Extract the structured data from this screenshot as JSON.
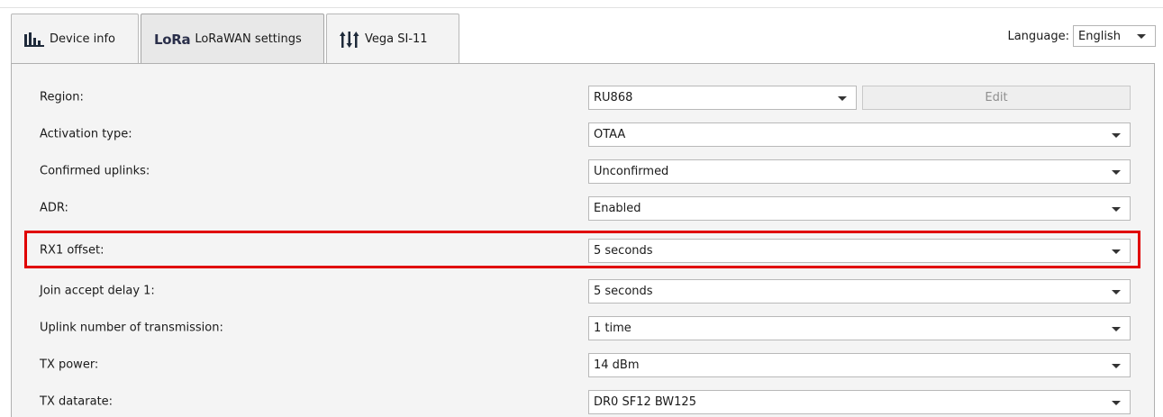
{
  "tabs": [
    {
      "label": "Device info",
      "icon": "bar-chart-icon"
    },
    {
      "label": "LoRaWAN settings",
      "logo_text": "LoRa",
      "icon": "lora-logo-icon"
    },
    {
      "label": "Vega SI-11",
      "icon": "sliders-icon"
    }
  ],
  "active_tab": "LoRaWAN settings",
  "language": {
    "label": "Language:",
    "value": "English"
  },
  "settings": {
    "region": {
      "label": "Region:",
      "value": "RU868",
      "edit_label": "Edit"
    },
    "activation_type": {
      "label": "Activation type:",
      "value": "OTAA"
    },
    "confirmed_uplinks": {
      "label": "Confirmed uplinks:",
      "value": "Unconfirmed"
    },
    "adr": {
      "label": "ADR:",
      "value": "Enabled"
    },
    "rx1_offset": {
      "label": "RX1 offset:",
      "value": "5 seconds"
    },
    "join_accept_delay": {
      "label": "Join accept delay 1:",
      "value": "5 seconds"
    },
    "uplink_transmissions": {
      "label": "Uplink number of transmission:",
      "value": "1 time"
    },
    "tx_power": {
      "label": "TX power:",
      "value": "14 dBm"
    },
    "tx_datarate": {
      "label": "TX datarate:",
      "value": "DR0 SF12 BW125"
    }
  },
  "colors": {
    "highlight": "#e00000",
    "panel_bg": "#f4f4f4"
  }
}
